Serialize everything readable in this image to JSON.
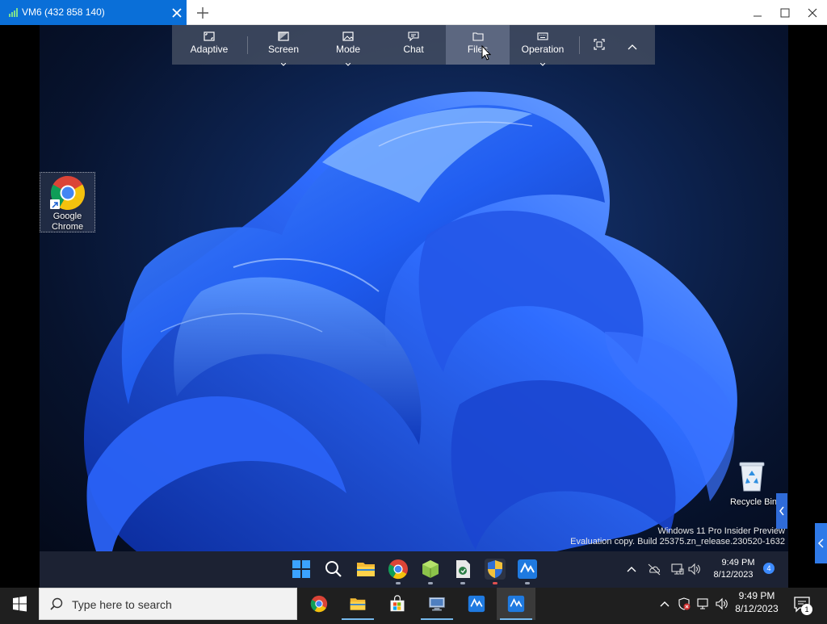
{
  "window": {
    "tab_title": "VM6 (432 858 140)",
    "colors": {
      "tab_bg": "#0a6fd8",
      "signal": "#7ee08e"
    }
  },
  "remote_toolbar": {
    "buttons": [
      {
        "label": "Adaptive",
        "icon": "fit-screen-icon",
        "has_caret": false
      },
      {
        "label": "Screen",
        "icon": "screen-icon",
        "has_caret": true
      },
      {
        "label": "Mode",
        "icon": "image-icon",
        "has_caret": true
      },
      {
        "label": "Chat",
        "icon": "chat-icon",
        "has_caret": false
      },
      {
        "label": "Files",
        "icon": "folder-icon",
        "has_caret": false,
        "active": true
      },
      {
        "label": "Operation",
        "icon": "keyboard-icon",
        "has_caret": true
      }
    ],
    "extra_icons": [
      "fullscreen-icon",
      "collapse-up-icon"
    ]
  },
  "desktop": {
    "icons": [
      {
        "label_line1": "Google",
        "label_line2": "Chrome",
        "icon": "chrome-icon"
      },
      {
        "label": "Recycle Bin",
        "icon": "recycle-bin-icon"
      }
    ],
    "watermark_line1": "Windows 11 Pro Insider Preview",
    "watermark_line2": "Evaluation copy. Build 25375.zn_release.230520-1632"
  },
  "remote_taskbar": {
    "apps": [
      "windows-start-icon",
      "search-icon",
      "file-explorer-icon",
      "chrome-icon",
      "app-cube-icon",
      "app-doc-icon",
      "shield-icon",
      "app-remote-icon"
    ],
    "time": "9:49 PM",
    "date": "8/12/2023",
    "badge": "4"
  },
  "local_taskbar": {
    "search_placeholder": "Type here to search",
    "apps": [
      "chrome-icon",
      "file-explorer-icon",
      "store-icon",
      "network-computer-icon",
      "remote-app-icon",
      "remote-app-icon"
    ],
    "time": "9:49 PM",
    "date": "8/12/2023",
    "notification_count": "1"
  }
}
